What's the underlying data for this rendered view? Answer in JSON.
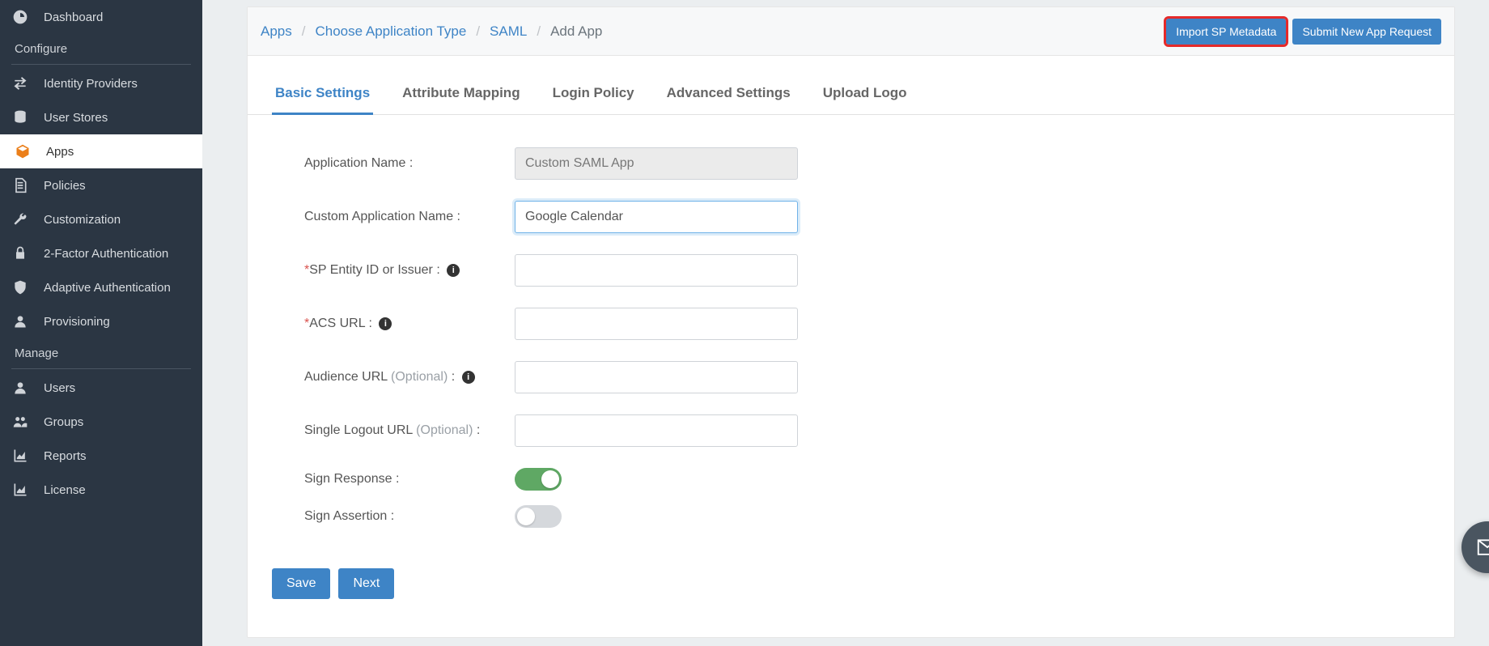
{
  "sidebar": {
    "items": [
      {
        "label": "Dashboard",
        "icon": "dashboard-icon"
      }
    ],
    "sections": [
      {
        "header": "Configure",
        "items": [
          {
            "label": "Identity Providers",
            "icon": "swap-icon"
          },
          {
            "label": "User Stores",
            "icon": "database-icon"
          },
          {
            "label": "Apps",
            "icon": "box-icon",
            "active": true
          },
          {
            "label": "Policies",
            "icon": "document-icon"
          },
          {
            "label": "Customization",
            "icon": "wrench-icon"
          },
          {
            "label": "2-Factor Authentication",
            "icon": "lock-icon"
          },
          {
            "label": "Adaptive Authentication",
            "icon": "shield-icon"
          },
          {
            "label": "Provisioning",
            "icon": "user-icon"
          }
        ]
      },
      {
        "header": "Manage",
        "items": [
          {
            "label": "Users",
            "icon": "user-icon"
          },
          {
            "label": "Groups",
            "icon": "users-icon"
          },
          {
            "label": "Reports",
            "icon": "chart-icon"
          },
          {
            "label": "License",
            "icon": "chart-icon"
          }
        ]
      }
    ]
  },
  "breadcrumb": {
    "items": [
      {
        "label": "Apps",
        "link": true
      },
      {
        "label": "Choose Application Type",
        "link": true
      },
      {
        "label": "SAML",
        "link": true
      },
      {
        "label": "Add App",
        "link": false
      }
    ]
  },
  "header_buttons": {
    "import": "Import SP Metadata",
    "submit": "Submit New App Request"
  },
  "tabs": [
    {
      "label": "Basic Settings",
      "active": true
    },
    {
      "label": "Attribute Mapping"
    },
    {
      "label": "Login Policy"
    },
    {
      "label": "Advanced Settings"
    },
    {
      "label": "Upload Logo"
    }
  ],
  "form": {
    "app_name_label": "Application Name :",
    "app_name_value": "Custom SAML App",
    "custom_app_name_label": "Custom Application Name :",
    "custom_app_name_value": "Google Calendar",
    "sp_entity_label": "SP Entity ID or Issuer :",
    "sp_entity_value": "",
    "acs_label": "ACS URL :",
    "acs_value": "",
    "audience_label_a": "Audience URL ",
    "audience_opt": "(Optional)",
    "audience_label_b": " :",
    "audience_value": "",
    "slo_label_a": "Single Logout URL ",
    "slo_opt": "(Optional)",
    "slo_label_b": " :",
    "slo_value": "",
    "sign_response_label": "Sign Response :",
    "sign_response_on": true,
    "sign_assertion_label": "Sign Assertion :",
    "sign_assertion_on": false,
    "required_marker": "*"
  },
  "actions": {
    "save": "Save",
    "next": "Next"
  }
}
